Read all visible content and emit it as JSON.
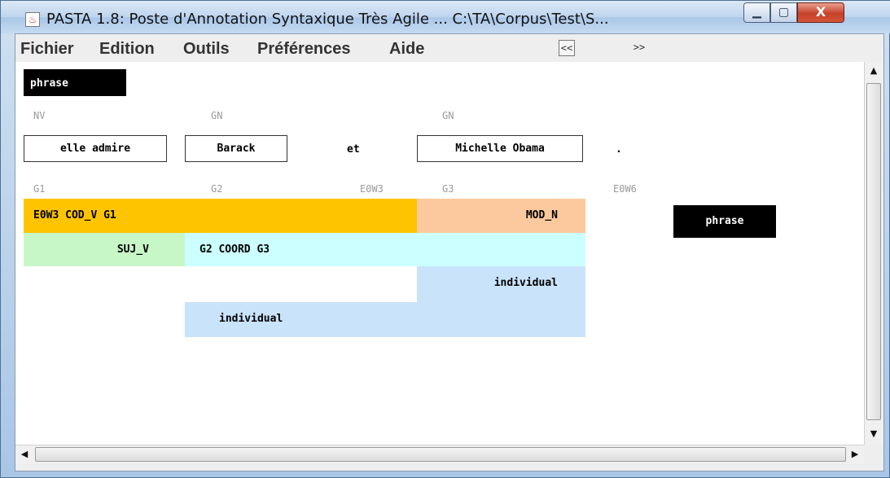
{
  "window": {
    "title": "PASTA 1.8: Poste d'Annotation Syntaxique Très Agile ... C:\\TA\\Corpus\\Test\\S...",
    "minimize_glyph": "▁",
    "maximize_glyph": "▢",
    "close_glyph": "X",
    "app_icon": "java-cup-icon"
  },
  "menu": {
    "items": [
      "Fichier",
      "Edition",
      "Outils",
      "Préférences",
      "Aide"
    ],
    "prev_label": "<<",
    "next_label": ">>"
  },
  "annotation": {
    "root_label": "phrase",
    "phrase_box_label": "phrase",
    "categories": {
      "c1": "NV",
      "c2": "GN",
      "c3": "GN"
    },
    "tokens": {
      "t1": "elle admire",
      "t2": "Barack",
      "t3": "et",
      "t4": "Michelle Obama",
      "t5": "."
    },
    "groups": {
      "g1": "G1",
      "g2": "G2",
      "g3": "E0W3",
      "g4": "G3",
      "g5": "E0W6"
    },
    "relations": {
      "rel1": "E0W3 COD_V G1",
      "rel2": "MOD_N",
      "rel3": "SUJ_V",
      "rel4": "G2 COORD G3",
      "rel5": "individual",
      "rel6": "individual"
    }
  },
  "colors": {
    "orange": "#ffc400",
    "peach": "#fbc99d",
    "green": "#c8f7c7",
    "cyan": "#ccffff",
    "blue": "#c9e3fb"
  },
  "scrollbar": {
    "up_arrow": "▲",
    "down_arrow": "▼",
    "left_arrow": "◀",
    "right_arrow": "▶"
  }
}
